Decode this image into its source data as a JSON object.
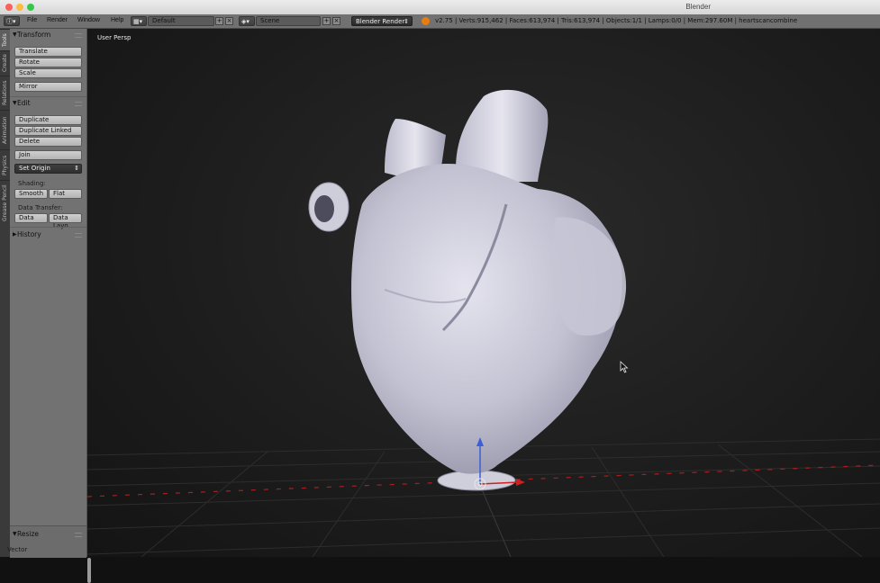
{
  "window": {
    "title": "Blender"
  },
  "info_header": {
    "menus": [
      "File",
      "Render",
      "Window",
      "Help"
    ],
    "screen_layout": "Default",
    "scene": "Scene",
    "render_engine": "Blender Render",
    "stats": "v2.75 | Verts:915,462 | Faces:613,974 | Tris:613,974 | Objects:1/1 | Lamps:0/0 | Mem:297.60M | heartscancombine"
  },
  "side_tabs": [
    "Tools",
    "Create",
    "Relations",
    "Animation",
    "Physics",
    "Grease Pencil"
  ],
  "tool_shelf": {
    "transform": {
      "title": "Transform",
      "buttons": [
        "Translate",
        "Rotate",
        "Scale",
        "Mirror"
      ]
    },
    "edit": {
      "title": "Edit",
      "buttons": [
        "Duplicate",
        "Duplicate Linked",
        "Delete",
        "Join"
      ],
      "set_origin": "Set Origin",
      "shading_label": "Shading:",
      "shading_smooth": "Smooth",
      "shading_flat": "Flat",
      "data_transfer_label": "Data Transfer:",
      "data_btn": "Data",
      "data_layout_btn": "Data Layo"
    },
    "history": {
      "title": "History"
    },
    "operator": {
      "title": "Resize",
      "label": "Vector"
    }
  },
  "viewport": {
    "view_name": "User Persp"
  },
  "colors": {
    "title_close": "#fc605c",
    "title_min": "#fdbc40",
    "title_max": "#34c84a",
    "axis_x": "#d02020",
    "axis_z": "#3a5fd8",
    "mesh": "#c9c8d6"
  }
}
